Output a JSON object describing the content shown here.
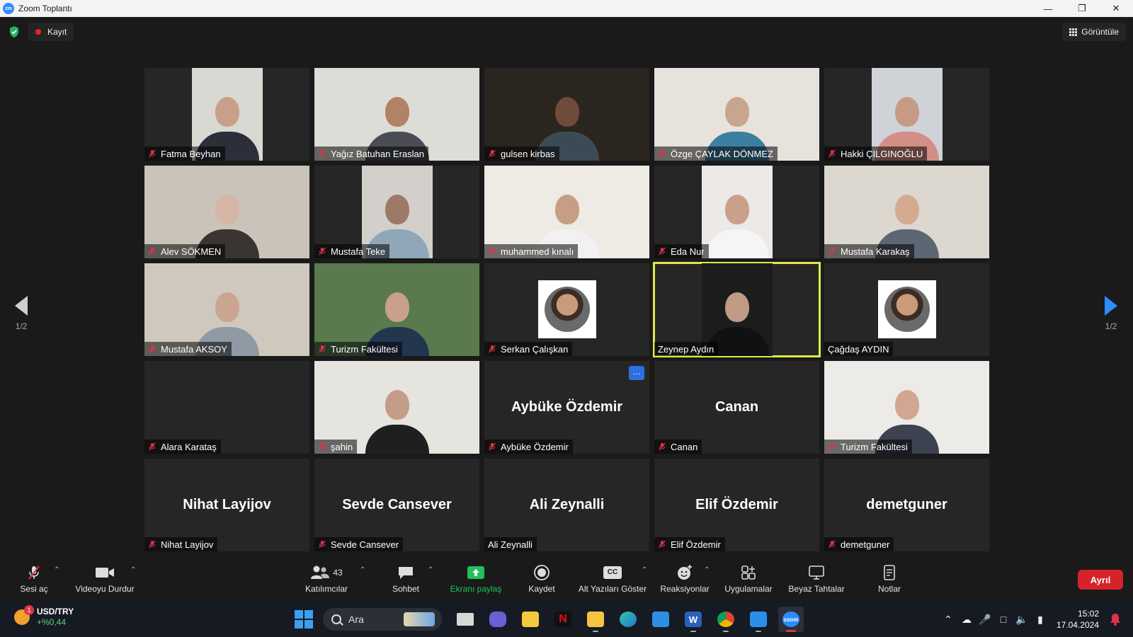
{
  "window": {
    "title": "Zoom Toplantı",
    "logo_text": "zm",
    "controls": [
      "minimize",
      "restore",
      "close"
    ]
  },
  "topbar": {
    "recording_label": "Kayıt",
    "view_label": "Görüntüle"
  },
  "paging": {
    "left": "1/2",
    "right": "1/2"
  },
  "participants": [
    {
      "name": "Fatma Beyhan",
      "muted": true,
      "kind": "video-narrow"
    },
    {
      "name": "Yağız Batuhan Eraslan",
      "muted": true,
      "kind": "video"
    },
    {
      "name": "gulsen kirbas",
      "muted": true,
      "kind": "video"
    },
    {
      "name": "Özge ÇAYLAK DÖNMEZ",
      "muted": true,
      "kind": "video"
    },
    {
      "name": "Hakki ÇILGINOĞLU",
      "muted": true,
      "kind": "video-narrow"
    },
    {
      "name": "Alev SÖKMEN",
      "muted": true,
      "kind": "video"
    },
    {
      "name": "Mustafa Teke",
      "muted": true,
      "kind": "video-narrow"
    },
    {
      "name": "muhammed kınalı",
      "muted": true,
      "kind": "video"
    },
    {
      "name": "Eda Nur",
      "muted": true,
      "kind": "video-narrow"
    },
    {
      "name": "Mustafa Karakaş",
      "muted": true,
      "kind": "video"
    },
    {
      "name": "Mustafa AKSOY",
      "muted": true,
      "kind": "video"
    },
    {
      "name": "Turizm Fakültesi",
      "muted": true,
      "kind": "video"
    },
    {
      "name": "Serkan Çalışkan",
      "muted": true,
      "kind": "avatar"
    },
    {
      "name": "Zeynep Aydın",
      "muted": false,
      "kind": "video-narrow",
      "active_speaker": true
    },
    {
      "name": "Çağdaş AYDIN",
      "muted": false,
      "kind": "avatar"
    },
    {
      "name": "Alara Karataş",
      "muted": true,
      "kind": "empty"
    },
    {
      "name": "şahin",
      "muted": true,
      "kind": "video"
    },
    {
      "name": "Aybüke Özdemir",
      "muted": true,
      "kind": "name",
      "display": "Aybüke Özdemir",
      "has_menu": true
    },
    {
      "name": "Canan",
      "muted": true,
      "kind": "name",
      "display": "Canan"
    },
    {
      "name": "Turizm Fakültesi",
      "muted": true,
      "kind": "video"
    },
    {
      "name": "Nihat Layijov",
      "muted": true,
      "kind": "name",
      "display": "Nihat Layijov"
    },
    {
      "name": "Sevde Cansever",
      "muted": true,
      "kind": "name",
      "display": "Sevde Cansever"
    },
    {
      "name": "Ali Zeynalli",
      "muted": false,
      "kind": "name",
      "display": "Ali Zeynalli"
    },
    {
      "name": "Elif Özdemir",
      "muted": true,
      "kind": "name",
      "display": "Elif Özdemir"
    },
    {
      "name": "demetguner",
      "muted": true,
      "kind": "name",
      "display": "demetguner"
    }
  ],
  "toolbar": {
    "unmute": "Sesi aç",
    "stop_video": "Videoyu Durdur",
    "participants": "Katılımcılar",
    "participants_count": "43",
    "chat": "Sohbet",
    "share_screen": "Ekranı paylaş",
    "record": "Kaydet",
    "captions": "Alt Yazıları Göster",
    "captions_icon_text": "CC",
    "reactions": "Reaksiyonlar",
    "apps": "Uygulamalar",
    "whiteboards": "Beyaz Tahtalar",
    "notes": "Notlar",
    "leave": "Ayrıl"
  },
  "taskbar": {
    "ticker_symbol": "USD/TRY",
    "ticker_change": "+%0,44",
    "ticker_badge": "1",
    "search_placeholder": "Ara",
    "time": "15:02",
    "date": "17.04.2024",
    "zoom_app_text": "zoom"
  },
  "colors": {
    "accent": "#2d8cff",
    "active_speaker_border": "#dfe84a",
    "leave": "#d5232b",
    "share": "#20c05c",
    "muted_icon": "#e0324b"
  }
}
